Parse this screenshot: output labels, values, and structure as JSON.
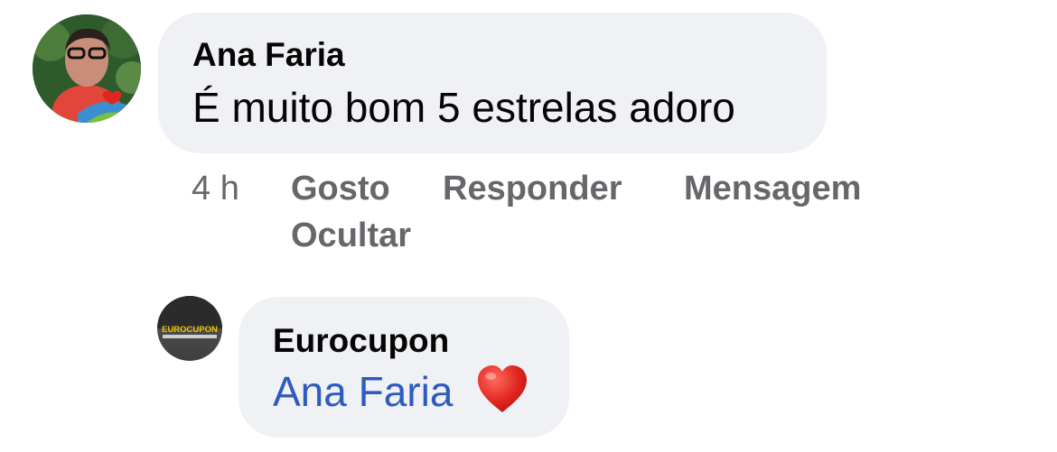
{
  "comment": {
    "author": "Ana Faria",
    "text": "É muito bom 5 estrelas adoro",
    "time": "4 h",
    "actions": {
      "like": "Gosto",
      "reply": "Responder",
      "message": "Mensagem",
      "hide": "Ocultar"
    }
  },
  "reply": {
    "author": "Eurocupon",
    "mention": "Ana Faria",
    "avatar_logo": "EUROCUPON",
    "reaction_icon": "red-heart-icon"
  },
  "colors": {
    "bubble": "#f0f1f5",
    "secondary_text": "#65676b",
    "mention": "#2e5bbf",
    "heart": "#e0261e"
  }
}
